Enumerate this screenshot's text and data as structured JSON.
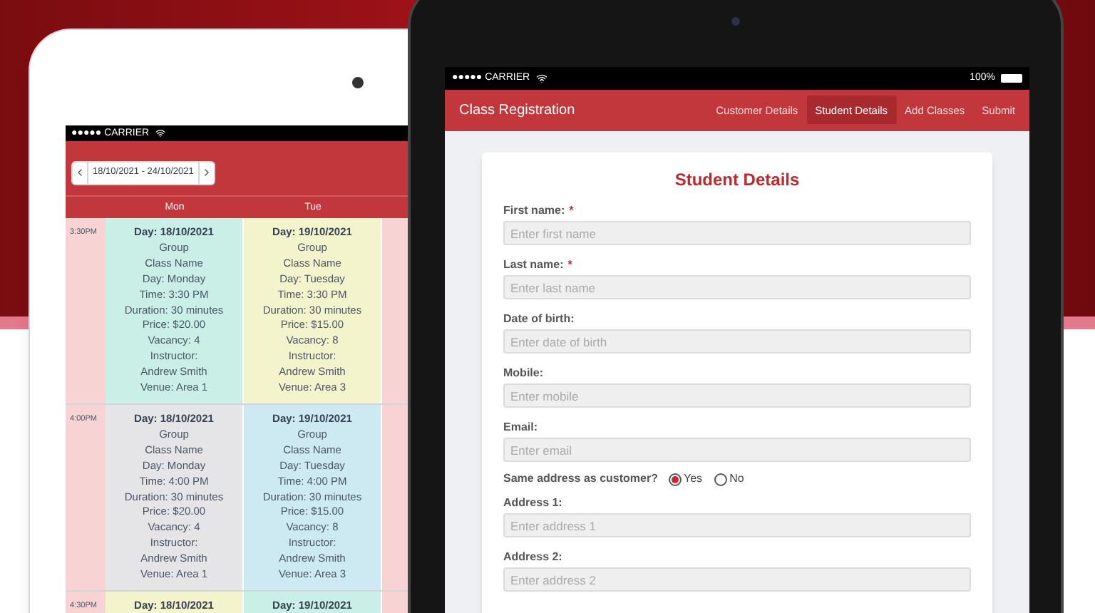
{
  "left_tablet": {
    "status_bar": {
      "carrier": "●●●●● CARRIER"
    },
    "date_range": "18/10/2021 - 24/10/2021",
    "days": [
      "Mon",
      "Tue"
    ],
    "rows": [
      {
        "time": "3:30PM",
        "cells": [
          {
            "color": "#c9efe6",
            "lines": [
              "Day: 18/10/2021",
              "Group",
              "Class Name",
              "Day: Monday",
              "Time: 3:30 PM",
              "Duration: 30 minutes",
              "Price: $20.00",
              "Vacancy: 4",
              "Instructor:",
              "Andrew Smith",
              "Venue: Area 1"
            ]
          },
          {
            "color": "#f4f4cc",
            "lines": [
              "Day: 19/10/2021",
              "Group",
              "Class Name",
              "Day: Tuesday",
              "Time: 3:30 PM",
              "Duration: 30 minutes",
              "Price: $15.00",
              "Vacancy: 8",
              "Instructor:",
              "Andrew Smith",
              "Venue: Area 3"
            ]
          }
        ]
      },
      {
        "time": "4:00PM",
        "cells": [
          {
            "color": "#e5e5e8",
            "lines": [
              "Day: 18/10/2021",
              "Group",
              "Class Name",
              "Day: Monday",
              "Time: 4:00 PM",
              "Duration: 30 minutes",
              "Price: $20.00",
              "Vacancy: 4",
              "Instructor:",
              "Andrew Smith",
              "Venue: Area 1"
            ]
          },
          {
            "color": "#cdeaf3",
            "lines": [
              "Day: 19/10/2021",
              "Group",
              "Class Name",
              "Day: Tuesday",
              "Time: 4:00 PM",
              "Duration: 30 minutes",
              "Price: $15.00",
              "Vacancy: 8",
              "Instructor:",
              "Andrew Smith",
              "Venue: Area 3"
            ]
          }
        ]
      },
      {
        "time": "4:30PM",
        "cells": [
          {
            "color": "#f4f4cc",
            "lines": [
              "Day: 18/10/2021"
            ]
          },
          {
            "color": "#c9efe6",
            "lines": [
              "Day: 19/10/2021"
            ]
          }
        ]
      }
    ]
  },
  "right_tablet": {
    "status_bar": {
      "carrier": "●●●●● CARRIER",
      "battery": "100%"
    },
    "app_title": "Class Registration",
    "tabs": [
      {
        "label": "Customer Details",
        "selected": false
      },
      {
        "label": "Student Details",
        "selected": true
      },
      {
        "label": "Add Classes",
        "selected": false
      },
      {
        "label": "Submit",
        "selected": false
      }
    ],
    "form": {
      "title": "Student Details",
      "fields": [
        {
          "kind": "input",
          "label": "First name:",
          "required_mark": "*",
          "placeholder": "Enter first name"
        },
        {
          "kind": "input",
          "label": "Last name:",
          "required_mark": "*",
          "placeholder": "Enter last name"
        },
        {
          "kind": "input",
          "label": "Date of birth:",
          "placeholder": "Enter date of birth"
        },
        {
          "kind": "input",
          "label": "Mobile:",
          "placeholder": "Enter mobile"
        },
        {
          "kind": "input",
          "label": "Email:",
          "placeholder": "Enter email"
        },
        {
          "kind": "radio",
          "label": "Same address as customer?",
          "options": [
            {
              "label": "Yes",
              "selected": true
            },
            {
              "label": "No",
              "selected": false
            }
          ]
        },
        {
          "kind": "input",
          "label": "Address 1:",
          "placeholder": "Enter address 1"
        },
        {
          "kind": "input",
          "label": "Address 2:",
          "placeholder": "Enter address 2"
        }
      ]
    }
  }
}
